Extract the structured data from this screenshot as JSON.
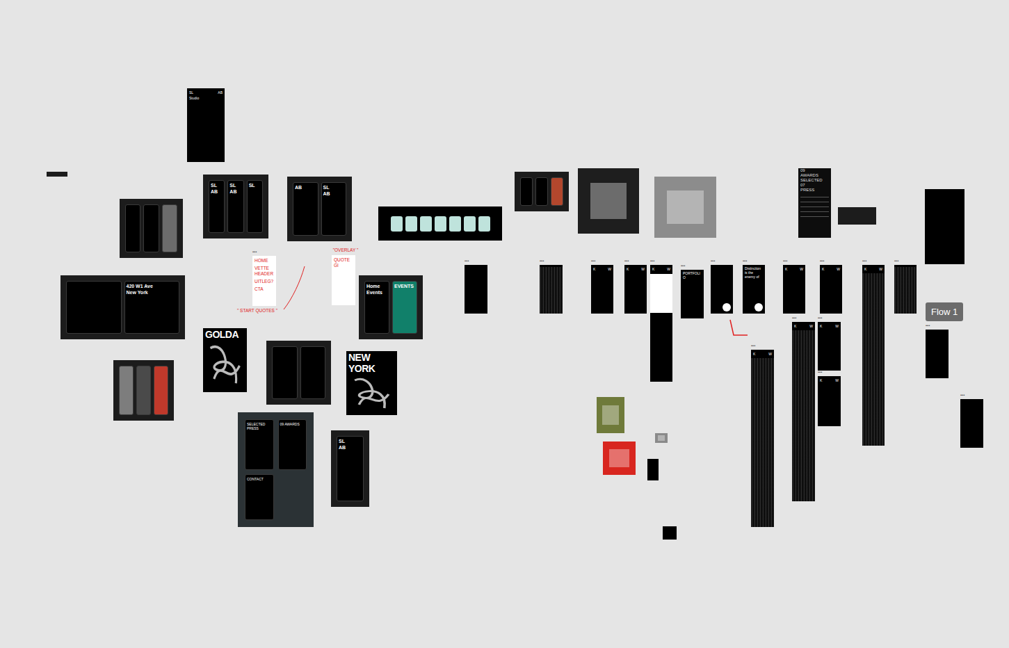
{
  "canvas": {
    "flow_tag": "Flow 1"
  },
  "frames": [
    {
      "kind": "strip",
      "label": "",
      "texts": [],
      "screens": []
    },
    {
      "kind": "phone",
      "label": "",
      "texts": [
        "SL",
        "AB",
        "Studio"
      ],
      "screens": []
    },
    {
      "kind": "board",
      "label": "",
      "texts": [],
      "screens": [
        {
          "texts": [],
          "color": "#000000"
        },
        {
          "texts": [],
          "color": "#000000"
        },
        {
          "texts": [],
          "color": "#6b6b6b"
        }
      ]
    },
    {
      "kind": "board",
      "label": "",
      "texts": [],
      "screens": [
        {
          "texts": [
            "SL",
            "AB"
          ],
          "color": "#000000"
        },
        {
          "texts": [
            "SL",
            "AB"
          ],
          "color": "#000000"
        },
        {
          "texts": [
            "SL"
          ],
          "color": "#000000"
        }
      ]
    },
    {
      "kind": "board",
      "label": "",
      "texts": [],
      "screens": [
        {
          "texts": [
            "AB"
          ],
          "color": "#000000"
        },
        {
          "texts": [
            "SL",
            "AB"
          ],
          "color": "#000000"
        }
      ]
    },
    {
      "kind": "cards",
      "label": "",
      "texts": [],
      "screens": [
        {
          "texts": [],
          "color": "#bfe3dc"
        },
        {
          "texts": [],
          "color": "#bfe3dc"
        },
        {
          "texts": [],
          "color": "#bfe3dc"
        },
        {
          "texts": [],
          "color": "#bfe3dc"
        },
        {
          "texts": [],
          "color": "#bfe3dc"
        },
        {
          "texts": [],
          "color": "#bfe3dc"
        },
        {
          "texts": [],
          "color": "#bfe3dc"
        }
      ]
    },
    {
      "kind": "board",
      "label": "",
      "texts": [],
      "screens": [
        {
          "texts": [],
          "color": "#000000"
        },
        {
          "texts": [
            "420 W1 Ave",
            "New York"
          ],
          "color": "#000000"
        }
      ]
    },
    {
      "kind": "board",
      "label": "",
      "texts": [],
      "screens": [
        {
          "texts": [],
          "color": "#7d7d7d"
        },
        {
          "texts": [],
          "color": "#4a4a4a"
        },
        {
          "texts": [],
          "color": "#c0392b"
        }
      ]
    },
    {
      "kind": "poster",
      "label": "",
      "texts": [
        "GOLDA"
      ],
      "screens": []
    },
    {
      "kind": "board",
      "label": "",
      "texts": [],
      "screens": [
        {
          "texts": [],
          "color": "#000000"
        },
        {
          "texts": [],
          "color": "#000000"
        }
      ]
    },
    {
      "kind": "poster",
      "label": "",
      "texts": [
        "NEW",
        "YORK"
      ],
      "screens": []
    },
    {
      "kind": "board",
      "label": "",
      "texts": [],
      "screens": [
        {
          "texts": [
            "Home",
            "Events"
          ],
          "color": "#000000"
        },
        {
          "texts": [
            "EVENTS"
          ],
          "color": "#11806a"
        }
      ]
    },
    {
      "kind": "slate",
      "label": "",
      "texts": [],
      "screens": [
        {
          "texts": [
            "SELECTED PRESS"
          ],
          "color": "#000000"
        },
        {
          "texts": [
            "09 AWARDS"
          ],
          "color": "#000000"
        },
        {
          "texts": [
            "CONTACT"
          ],
          "color": "#000000"
        }
      ]
    },
    {
      "kind": "board",
      "label": "",
      "texts": [],
      "screens": [
        {
          "texts": [
            "SL",
            "AB"
          ],
          "color": "#000000"
        }
      ]
    },
    {
      "kind": "note",
      "label": "•••",
      "texts": [
        "HOME",
        "VETTE HEADER",
        "UITLEG?",
        "CTA"
      ],
      "screens": []
    },
    {
      "kind": "caption",
      "label": "",
      "texts": [
        "\" START QUOTES \""
      ],
      "screens": []
    },
    {
      "kind": "caption",
      "label": "",
      "texts": [
        "\"OVERLAY \""
      ],
      "screens": []
    },
    {
      "kind": "note",
      "label": "",
      "texts": [
        "QUOTE GI"
      ],
      "screens": []
    },
    {
      "kind": "phone",
      "label": "•••",
      "texts": [],
      "screens": []
    },
    {
      "kind": "board",
      "label": "",
      "texts": [],
      "screens": [
        {
          "texts": [],
          "color": "#000000"
        },
        {
          "texts": [],
          "color": "#000000"
        },
        {
          "texts": [],
          "color": "#b3472d"
        }
      ]
    },
    {
      "kind": "photo",
      "label": "",
      "texts": [],
      "screens": [],
      "color": "#1e1e1e"
    },
    {
      "kind": "photo",
      "label": "",
      "texts": [],
      "screens": [],
      "color": "#8c8c8c"
    },
    {
      "kind": "list",
      "label": "",
      "texts": [
        "09",
        "AWARDS",
        "SELECTED",
        "07",
        "PRESS"
      ],
      "screens": []
    },
    {
      "kind": "strip",
      "label": "",
      "texts": [],
      "screens": []
    },
    {
      "kind": "phone",
      "label": "",
      "texts": [],
      "screens": []
    },
    {
      "kind": "texture",
      "label": "•••",
      "texts": [],
      "screens": []
    },
    {
      "kind": "phone",
      "label": "•••",
      "texts": [
        "K",
        "W"
      ],
      "screens": []
    },
    {
      "kind": "phone",
      "label": "•••",
      "texts": [
        "K",
        "W"
      ],
      "screens": []
    },
    {
      "kind": "split",
      "label": "•••",
      "texts": [
        "K",
        "W"
      ],
      "screens": []
    },
    {
      "kind": "phone",
      "label": "•••",
      "texts": [
        "PORTFOLIO"
      ],
      "screens": []
    },
    {
      "kind": "phone-dot",
      "label": "•••",
      "texts": [],
      "screens": []
    },
    {
      "kind": "phone-dot",
      "label": "•••",
      "texts": [
        "Distinction is the enemy of"
      ],
      "screens": []
    },
    {
      "kind": "phone",
      "label": "•••",
      "texts": [
        "K",
        "W"
      ],
      "screens": []
    },
    {
      "kind": "phone",
      "label": "•••",
      "texts": [
        "K",
        "W"
      ],
      "screens": []
    },
    {
      "kind": "texture",
      "label": "•••",
      "texts": [
        "K",
        "W"
      ],
      "screens": []
    },
    {
      "kind": "texture",
      "label": "•••",
      "texts": [],
      "screens": []
    },
    {
      "kind": "texture",
      "label": "•••",
      "texts": [
        "K",
        "W"
      ],
      "screens": []
    },
    {
      "kind": "texture",
      "label": "•••",
      "texts": [
        "K",
        "W"
      ],
      "screens": []
    },
    {
      "kind": "phone",
      "label": "•••",
      "texts": [
        "K",
        "W"
      ],
      "screens": []
    },
    {
      "kind": "phone",
      "label": "•••",
      "texts": [
        "K",
        "W"
      ],
      "screens": []
    },
    {
      "kind": "phone",
      "label": "•••",
      "texts": [],
      "screens": []
    },
    {
      "kind": "phone",
      "label": "•••",
      "texts": [],
      "screens": []
    },
    {
      "kind": "photo",
      "label": "",
      "texts": [],
      "screens": [],
      "color": "#6f7a3a"
    },
    {
      "kind": "photo",
      "label": "",
      "texts": [],
      "screens": [],
      "color": "#d8261f"
    },
    {
      "kind": "photo",
      "label": "",
      "texts": [],
      "screens": [],
      "color": "#8a8a8a"
    },
    {
      "kind": "phone",
      "label": "",
      "texts": [],
      "screens": []
    },
    {
      "kind": "phone",
      "label": "",
      "texts": [],
      "screens": []
    }
  ]
}
